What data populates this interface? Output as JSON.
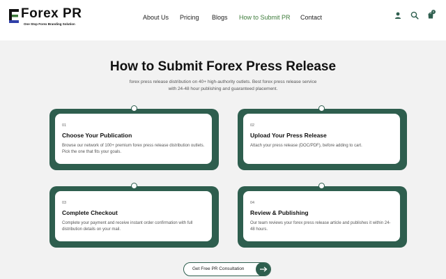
{
  "brand": {
    "name": "Forex PR",
    "tagline": "One Stop Forex Branding Solution"
  },
  "nav": {
    "items": [
      "About Us",
      "Pricing",
      "Blogs",
      "How to Submit PR",
      "Contact"
    ],
    "active": "How to Submit PR"
  },
  "header_icons": [
    "user-icon",
    "search-icon",
    "cart-icon"
  ],
  "cart_count": "0",
  "hero": {
    "title": "How to Submit Forex Press Release",
    "subtitle": "forex press release distribution on 40+ high-authority outlets. Best forex press release service with 24-48 hour publishing and guaranteed placement."
  },
  "steps": [
    {
      "number": "01",
      "title": "Choose Your Publication",
      "description": "Browse our network of 100+ premium forex press release distribution outlets. Pick the one that fits your goals."
    },
    {
      "number": "02",
      "title": "Upload Your Press Release",
      "description": "Attach your press release (DOC/PDF), before adding to cart."
    },
    {
      "number": "03",
      "title": "Complete Checkout",
      "description": "Complete your payment and receive instant order confirmation with full distribution details on your mail."
    },
    {
      "number": "04",
      "title": "Review & Publishing",
      "description": "Our team reviews your forex press release article and publishes it within 24-48 hours."
    }
  ],
  "cta": {
    "label": "Get Free PR Consultation"
  },
  "colors": {
    "accent": "#2e5e4e",
    "nav_active": "#3d7b3a",
    "background": "#f2f2f2"
  }
}
